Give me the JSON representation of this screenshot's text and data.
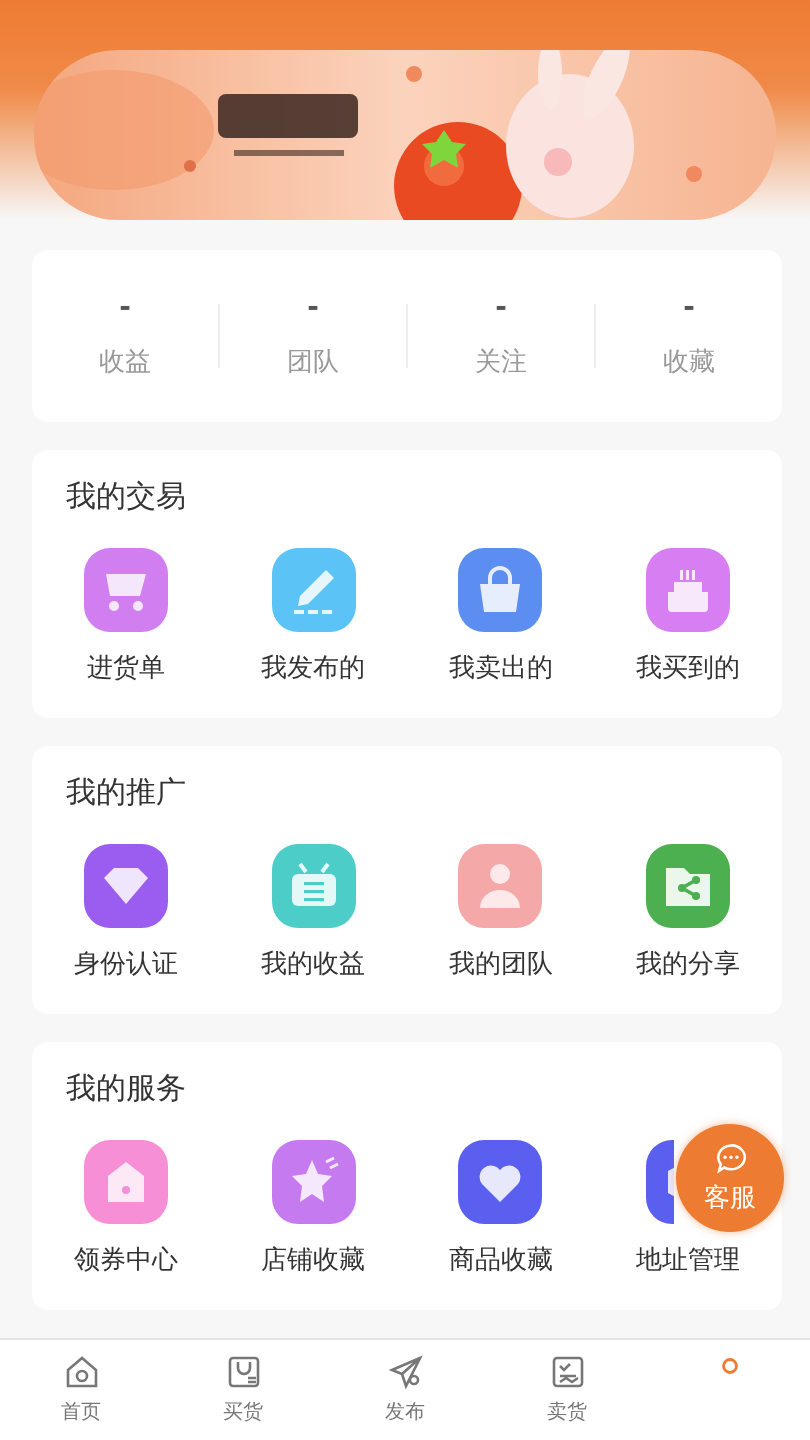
{
  "stats": [
    {
      "value": "-",
      "label": "收益"
    },
    {
      "value": "-",
      "label": "团队"
    },
    {
      "value": "-",
      "label": "关注"
    },
    {
      "value": "-",
      "label": "收藏"
    }
  ],
  "sections": [
    {
      "title": "我的交易",
      "items": [
        {
          "label": "进货单",
          "color": "#d17ef0"
        },
        {
          "label": "我发布的",
          "color": "#5bc3f5"
        },
        {
          "label": "我卖出的",
          "color": "#5b8ef0"
        },
        {
          "label": "我买到的",
          "color": "#d77ef2"
        }
      ]
    },
    {
      "title": "我的推广",
      "items": [
        {
          "label": "身份认证",
          "color": "#9b5cf0"
        },
        {
          "label": "我的收益",
          "color": "#4ccdc8"
        },
        {
          "label": "我的团队",
          "color": "#f5a8a8"
        },
        {
          "label": "我的分享",
          "color": "#4caf50"
        }
      ]
    },
    {
      "title": "我的服务",
      "items": [
        {
          "label": "领券中心",
          "color": "#f78fd6"
        },
        {
          "label": "店铺收藏",
          "color": "#c57af0"
        },
        {
          "label": "商品收藏",
          "color": "#5b5ff0"
        },
        {
          "label": "地址管理",
          "color": "#5b5ff0"
        }
      ]
    }
  ],
  "float_button": {
    "label": "客服"
  },
  "tabs": [
    {
      "label": "首页",
      "selected": false
    },
    {
      "label": "买货",
      "selected": false
    },
    {
      "label": "发布",
      "selected": false
    },
    {
      "label": "卖货",
      "selected": false
    },
    {
      "selected": true
    }
  ]
}
